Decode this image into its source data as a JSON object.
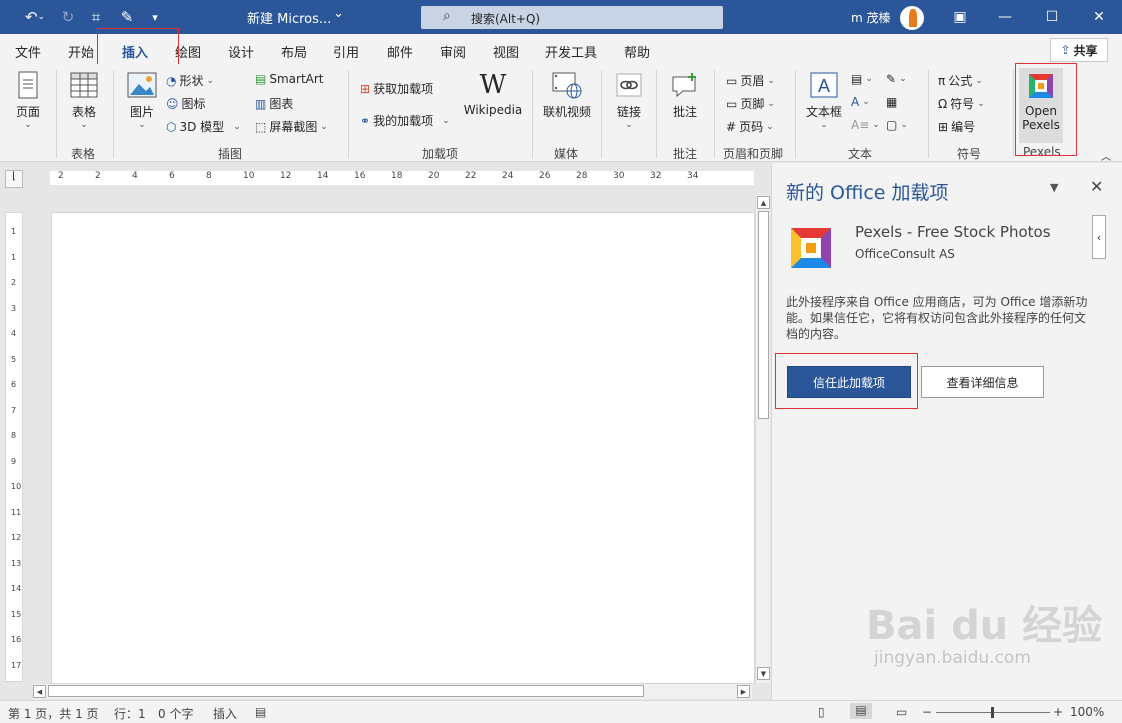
{
  "window": {
    "title": "新建 Micros...",
    "search": {
      "icon": "search-icon",
      "placeholder": "搜索(Alt+Q)"
    },
    "user": "m 茂榛",
    "controls": [
      "restore-down",
      "minimize",
      "maximize",
      "close"
    ]
  },
  "colors": {
    "brand": "#2b579a",
    "highlight": "#e0303a"
  },
  "tabs": [
    "文件",
    "开始",
    "插入",
    "绘图",
    "设计",
    "布局",
    "引用",
    "邮件",
    "审阅",
    "视图",
    "开发工具",
    "帮助"
  ],
  "active_tab": "插入",
  "share_label": "共享",
  "ribbon": {
    "pages": {
      "label": "页面",
      "group": ""
    },
    "tables": {
      "label": "表格",
      "group": "表格"
    },
    "illustrations": {
      "picture": "图片",
      "shapes": "形状",
      "icons": "图标",
      "models3d": "3D 模型",
      "smartart": "SmartArt",
      "chart": "图表",
      "screenshot": "屏幕截图",
      "group": "插图"
    },
    "addins": {
      "get": "获取加载项",
      "mine": "我的加载项",
      "wikipedia": "Wikipedia",
      "group": "加载项"
    },
    "media": {
      "online_video": "联机视频",
      "group": "媒体"
    },
    "links": {
      "label": "链接"
    },
    "comments": {
      "label": "批注",
      "group": "批注"
    },
    "header_footer": {
      "header": "页眉",
      "footer": "页脚",
      "page_number": "页码",
      "group": "页眉和页脚"
    },
    "text": {
      "textbox": "文本框",
      "group": "文本"
    },
    "symbols": {
      "equation": "公式",
      "symbol": "符号",
      "number": "编号",
      "group": "符号"
    },
    "pexels": {
      "label_line1": "Open",
      "label_line2": "Pexels",
      "group": "Pexels"
    }
  },
  "ruler": {
    "ticks": [
      "2",
      "2",
      "4",
      "6",
      "8",
      "10",
      "12",
      "14",
      "16",
      "18",
      "20",
      "22",
      "24",
      "26",
      "28",
      "30",
      "32",
      "34"
    ]
  },
  "vruler": {
    "ticks": [
      "1",
      "1",
      "2",
      "3",
      "4",
      "5",
      "6",
      "7",
      "8",
      "9",
      "10",
      "11",
      "12",
      "13",
      "14",
      "15",
      "16",
      "17"
    ]
  },
  "pane": {
    "title": "新的 Office 加载项",
    "addin_name": "Pexels - Free Stock Photos",
    "publisher": "OfficeConsult AS",
    "description": "此外接程序来自 Office 应用商店，可为 Office 增添新功能。如果信任它，它将有权访问包含此外接程序的任何文档的内容。",
    "trust_button": "信任此加载项",
    "details_button": "查看详细信息"
  },
  "watermark": {
    "logo": "Bai du 经验",
    "url": "jingyan.baidu.com"
  },
  "status": {
    "page": "第 1 页，共 1 页",
    "line": "行：1",
    "words": "0 个字",
    "mode": "插入",
    "zoom": "100%"
  }
}
